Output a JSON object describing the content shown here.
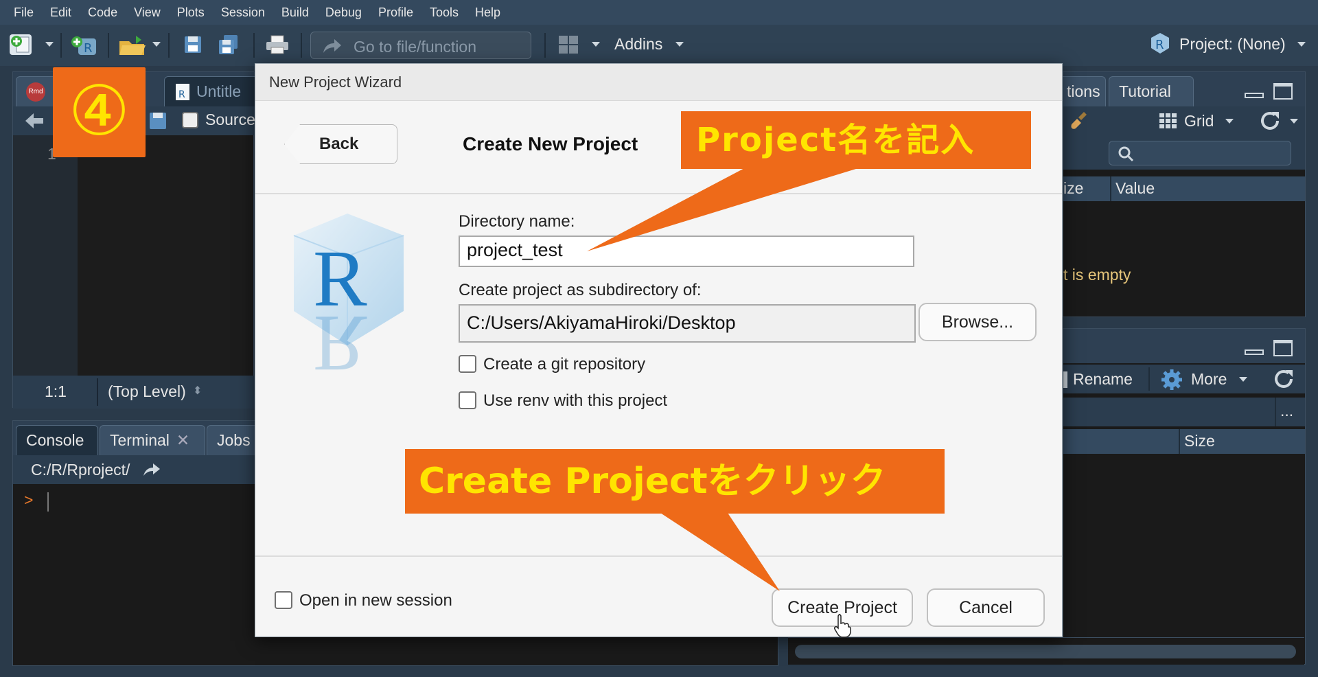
{
  "menu": [
    "File",
    "Edit",
    "Code",
    "View",
    "Plots",
    "Session",
    "Build",
    "Debug",
    "Profile",
    "Tools",
    "Help"
  ],
  "toolbar": {
    "goto_placeholder": "Go to file/function",
    "addins_label": "Addins",
    "project_label": "Project: (None)"
  },
  "source_pane": {
    "tab_rmd_icon": "Rmd",
    "tab_untitled": "Untitle",
    "source_on_save": "Source",
    "line_number": "1",
    "position": "1:1",
    "scope": "(Top Level)"
  },
  "console_pane": {
    "tabs": [
      "Console",
      "Terminal",
      "Jobs"
    ],
    "path": "C:/R/Rproject/",
    "prompt": ">"
  },
  "env_pane": {
    "tabs": [
      "tions",
      "Tutorial"
    ],
    "grid_label": "Grid",
    "col_size": "ize",
    "col_value": "Value",
    "empty_text": "t is empty"
  },
  "files_pane": {
    "rename_label": "Rename",
    "more_label": "More",
    "col_size": "Size",
    "ellipsis": "..."
  },
  "dialog": {
    "title": "New Project Wizard",
    "back_label": "Back",
    "heading": "Create New Project",
    "dir_name_label": "Directory name:",
    "dir_name_value": "project_test",
    "subdir_label": "Create project as subdirectory of:",
    "subdir_value": "C:/Users/AkiyamaHiroki/Desktop",
    "browse_label": "Browse...",
    "git_label": "Create a git repository",
    "renv_label": "Use renv with this project",
    "new_session_label": "Open in new session",
    "create_label": "Create Project",
    "cancel_label": "Cancel"
  },
  "annotations": {
    "step_badge": "④",
    "callout_name": "Project名を記入",
    "callout_create": "Create  Projectをクリック"
  },
  "colors": {
    "callout_bg": "#ee6a19",
    "callout_text": "#ffe500",
    "ide_bg": "#2a3a4a"
  }
}
